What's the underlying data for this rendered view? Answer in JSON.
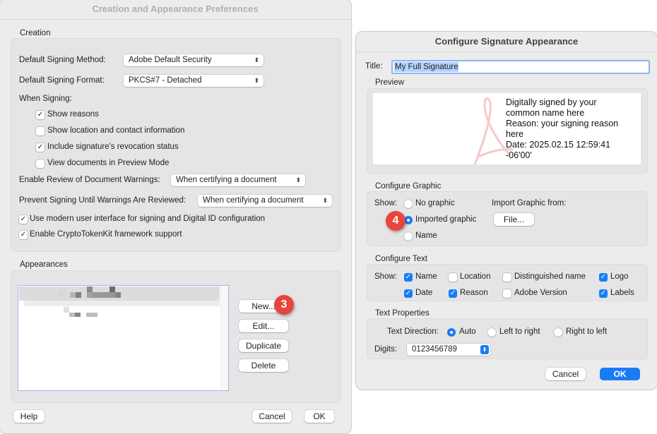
{
  "left_window": {
    "title": "Creation and Appearance Preferences",
    "creation_section": {
      "label": "Creation",
      "default_signing_method_label": "Default Signing Method:",
      "default_signing_method_value": "Adobe Default Security",
      "default_signing_format_label": "Default Signing Format:",
      "default_signing_format_value": "PKCS#7 - Detached",
      "when_signing_label": "When Signing:",
      "when_signing_options": [
        {
          "label": "Show reasons",
          "checked": true
        },
        {
          "label": "Show location and contact information",
          "checked": false
        },
        {
          "label": "Include signature's revocation status",
          "checked": true
        },
        {
          "label": "View documents in Preview Mode",
          "checked": false
        }
      ],
      "enable_review_label": "Enable Review of Document Warnings:",
      "enable_review_value": "When certifying a document",
      "prevent_signing_label": "Prevent Signing Until Warnings Are Reviewed:",
      "prevent_signing_value": "When certifying a document",
      "modern_ui": {
        "label": "Use modern user interface for signing and Digital ID configuration",
        "checked": true
      },
      "cryptotokenkit": {
        "label": "Enable CryptoTokenKit framework support",
        "checked": true
      }
    },
    "appearances_section": {
      "label": "Appearances",
      "buttons": {
        "new": "New...",
        "edit": "Edit...",
        "duplicate": "Duplicate",
        "delete": "Delete"
      }
    },
    "footer": {
      "help": "Help",
      "cancel": "Cancel",
      "ok": "OK"
    },
    "step_badge": "3"
  },
  "right_window": {
    "title": "Configure Signature Appearance",
    "title_field_label": "Title:",
    "title_field_value": "My Full Signature",
    "preview": {
      "label": "Preview",
      "lines": [
        "Digitally signed by your",
        "common name here",
        "Reason: your signing reason",
        "here",
        "Date: 2025.02.15 12:59:41",
        "-06'00'"
      ]
    },
    "configure_graphic": {
      "label": "Configure Graphic",
      "show_label": "Show:",
      "options": [
        {
          "label": "No graphic",
          "selected": false
        },
        {
          "label": "Imported graphic",
          "selected": true
        },
        {
          "label": "Name",
          "selected": false
        }
      ],
      "import_label": "Import Graphic from:",
      "file_button": "File..."
    },
    "configure_text": {
      "label": "Configure Text",
      "show_label": "Show:",
      "options": [
        {
          "label": "Name",
          "checked": true
        },
        {
          "label": "Location",
          "checked": false
        },
        {
          "label": "Distinguished name",
          "checked": false
        },
        {
          "label": "Logo",
          "checked": true
        },
        {
          "label": "Date",
          "checked": true
        },
        {
          "label": "Reason",
          "checked": true
        },
        {
          "label": "Adobe Version",
          "checked": false
        },
        {
          "label": "Labels",
          "checked": true
        }
      ]
    },
    "text_properties": {
      "label": "Text Properties",
      "direction_label": "Text Direction:",
      "direction_options": [
        {
          "label": "Auto",
          "selected": true
        },
        {
          "label": "Left to right",
          "selected": false
        },
        {
          "label": "Right to left",
          "selected": false
        }
      ],
      "digits_label": "Digits:",
      "digits_value": "0123456789"
    },
    "footer": {
      "cancel": "Cancel",
      "ok": "OK"
    },
    "step_badge": "4"
  },
  "colors": {
    "accent": "#1a7cf5",
    "badge": "#e8453c",
    "window_bg": "#ececec",
    "group_bg": "#e5e5e5"
  }
}
